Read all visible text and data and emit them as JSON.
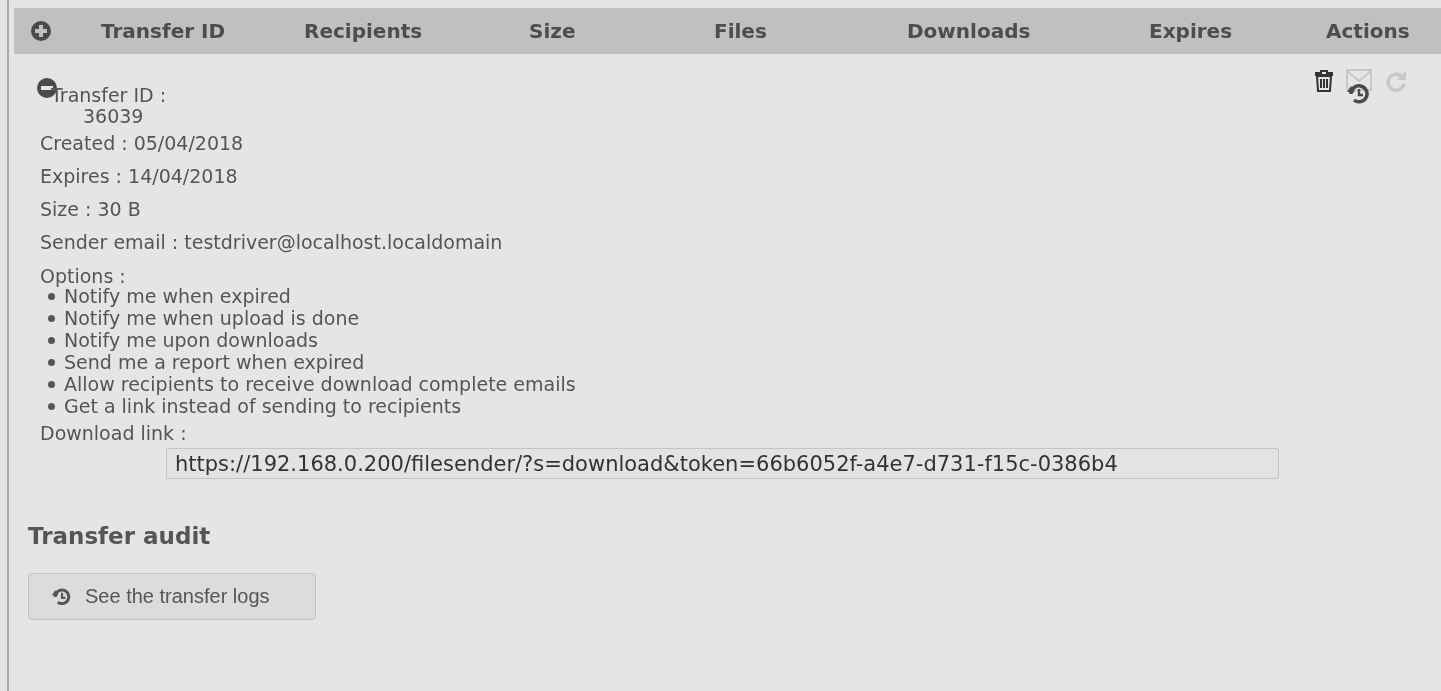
{
  "table": {
    "columns": [
      "Transfer ID",
      "Recipients",
      "Size",
      "Files",
      "Downloads",
      "Expires",
      "Actions"
    ],
    "expanded": true
  },
  "actions": [
    {
      "kind": "delete",
      "disabled": false
    },
    {
      "kind": "remind",
      "disabled": true
    },
    {
      "kind": "extend",
      "disabled": true
    },
    {
      "kind": "history",
      "disabled": false
    }
  ],
  "details": {
    "transfer_id_label": "Transfer ID :",
    "transfer_id": "36039",
    "fields": [
      "Created : 05/04/2018",
      "Expires : 14/04/2018",
      "Size : 30 B",
      "Sender email : testdriver@localhost.localdomain"
    ],
    "options_label": "Options :",
    "options": [
      "Notify me when expired",
      "Notify me when upload is done",
      "Notify me upon downloads",
      "Send me a report when expired",
      "Allow recipients to receive download complete emails",
      "Get a link instead of sending to recipients"
    ],
    "download_label": "Download link :",
    "download_link": "https://192.168.0.200/filesender/?s=download&token=66b6052f-a4e7-d731-f15c-0386b4"
  },
  "audit": {
    "title": "Transfer audit",
    "button": "See the transfer logs"
  }
}
